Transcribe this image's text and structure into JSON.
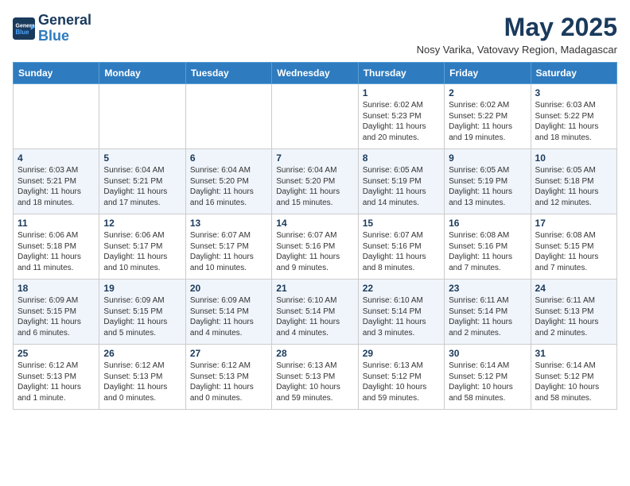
{
  "header": {
    "logo_line1": "General",
    "logo_line2": "Blue",
    "month": "May 2025",
    "location": "Nosy Varika, Vatovavy Region, Madagascar"
  },
  "weekdays": [
    "Sunday",
    "Monday",
    "Tuesday",
    "Wednesday",
    "Thursday",
    "Friday",
    "Saturday"
  ],
  "weeks": [
    [
      {
        "day": "",
        "info": ""
      },
      {
        "day": "",
        "info": ""
      },
      {
        "day": "",
        "info": ""
      },
      {
        "day": "",
        "info": ""
      },
      {
        "day": "1",
        "info": "Sunrise: 6:02 AM\nSunset: 5:23 PM\nDaylight: 11 hours and 20 minutes."
      },
      {
        "day": "2",
        "info": "Sunrise: 6:02 AM\nSunset: 5:22 PM\nDaylight: 11 hours and 19 minutes."
      },
      {
        "day": "3",
        "info": "Sunrise: 6:03 AM\nSunset: 5:22 PM\nDaylight: 11 hours and 18 minutes."
      }
    ],
    [
      {
        "day": "4",
        "info": "Sunrise: 6:03 AM\nSunset: 5:21 PM\nDaylight: 11 hours and 18 minutes."
      },
      {
        "day": "5",
        "info": "Sunrise: 6:04 AM\nSunset: 5:21 PM\nDaylight: 11 hours and 17 minutes."
      },
      {
        "day": "6",
        "info": "Sunrise: 6:04 AM\nSunset: 5:20 PM\nDaylight: 11 hours and 16 minutes."
      },
      {
        "day": "7",
        "info": "Sunrise: 6:04 AM\nSunset: 5:20 PM\nDaylight: 11 hours and 15 minutes."
      },
      {
        "day": "8",
        "info": "Sunrise: 6:05 AM\nSunset: 5:19 PM\nDaylight: 11 hours and 14 minutes."
      },
      {
        "day": "9",
        "info": "Sunrise: 6:05 AM\nSunset: 5:19 PM\nDaylight: 11 hours and 13 minutes."
      },
      {
        "day": "10",
        "info": "Sunrise: 6:05 AM\nSunset: 5:18 PM\nDaylight: 11 hours and 12 minutes."
      }
    ],
    [
      {
        "day": "11",
        "info": "Sunrise: 6:06 AM\nSunset: 5:18 PM\nDaylight: 11 hours and 11 minutes."
      },
      {
        "day": "12",
        "info": "Sunrise: 6:06 AM\nSunset: 5:17 PM\nDaylight: 11 hours and 10 minutes."
      },
      {
        "day": "13",
        "info": "Sunrise: 6:07 AM\nSunset: 5:17 PM\nDaylight: 11 hours and 10 minutes."
      },
      {
        "day": "14",
        "info": "Sunrise: 6:07 AM\nSunset: 5:16 PM\nDaylight: 11 hours and 9 minutes."
      },
      {
        "day": "15",
        "info": "Sunrise: 6:07 AM\nSunset: 5:16 PM\nDaylight: 11 hours and 8 minutes."
      },
      {
        "day": "16",
        "info": "Sunrise: 6:08 AM\nSunset: 5:16 PM\nDaylight: 11 hours and 7 minutes."
      },
      {
        "day": "17",
        "info": "Sunrise: 6:08 AM\nSunset: 5:15 PM\nDaylight: 11 hours and 7 minutes."
      }
    ],
    [
      {
        "day": "18",
        "info": "Sunrise: 6:09 AM\nSunset: 5:15 PM\nDaylight: 11 hours and 6 minutes."
      },
      {
        "day": "19",
        "info": "Sunrise: 6:09 AM\nSunset: 5:15 PM\nDaylight: 11 hours and 5 minutes."
      },
      {
        "day": "20",
        "info": "Sunrise: 6:09 AM\nSunset: 5:14 PM\nDaylight: 11 hours and 4 minutes."
      },
      {
        "day": "21",
        "info": "Sunrise: 6:10 AM\nSunset: 5:14 PM\nDaylight: 11 hours and 4 minutes."
      },
      {
        "day": "22",
        "info": "Sunrise: 6:10 AM\nSunset: 5:14 PM\nDaylight: 11 hours and 3 minutes."
      },
      {
        "day": "23",
        "info": "Sunrise: 6:11 AM\nSunset: 5:14 PM\nDaylight: 11 hours and 2 minutes."
      },
      {
        "day": "24",
        "info": "Sunrise: 6:11 AM\nSunset: 5:13 PM\nDaylight: 11 hours and 2 minutes."
      }
    ],
    [
      {
        "day": "25",
        "info": "Sunrise: 6:12 AM\nSunset: 5:13 PM\nDaylight: 11 hours and 1 minute."
      },
      {
        "day": "26",
        "info": "Sunrise: 6:12 AM\nSunset: 5:13 PM\nDaylight: 11 hours and 0 minutes."
      },
      {
        "day": "27",
        "info": "Sunrise: 6:12 AM\nSunset: 5:13 PM\nDaylight: 11 hours and 0 minutes."
      },
      {
        "day": "28",
        "info": "Sunrise: 6:13 AM\nSunset: 5:13 PM\nDaylight: 10 hours and 59 minutes."
      },
      {
        "day": "29",
        "info": "Sunrise: 6:13 AM\nSunset: 5:12 PM\nDaylight: 10 hours and 59 minutes."
      },
      {
        "day": "30",
        "info": "Sunrise: 6:14 AM\nSunset: 5:12 PM\nDaylight: 10 hours and 58 minutes."
      },
      {
        "day": "31",
        "info": "Sunrise: 6:14 AM\nSunset: 5:12 PM\nDaylight: 10 hours and 58 minutes."
      }
    ]
  ]
}
